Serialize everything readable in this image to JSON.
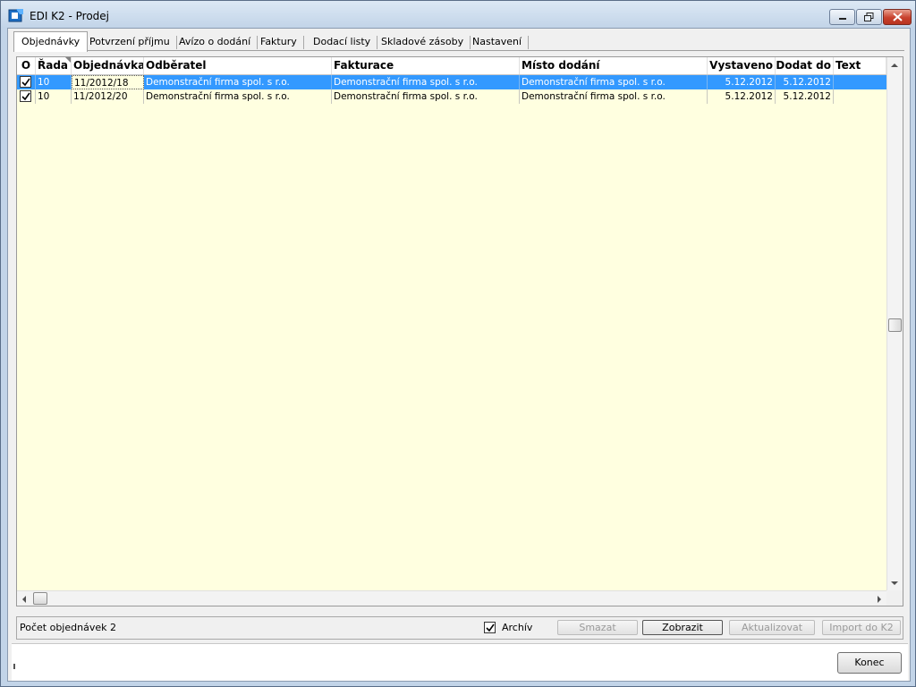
{
  "window": {
    "title": "EDI K2 - Prodej",
    "icon": "k2-app-icon"
  },
  "tabs": [
    {
      "label": "Objednávky",
      "active": true
    },
    {
      "label": "Potvrzení příjmu"
    },
    {
      "label": "Avízo o dodání"
    },
    {
      "label": "Faktury"
    },
    {
      "label": "Dodací listy"
    },
    {
      "label": "Skladové zásoby"
    },
    {
      "label": "Nastavení"
    }
  ],
  "grid": {
    "columns": [
      "O",
      "Řada",
      "Objednávka",
      "Odběratel",
      "Fakturace",
      "Místo dodání",
      "Vystaveno",
      "Dodat do",
      "Text"
    ],
    "rows": [
      {
        "checked": true,
        "rada": "10",
        "objednavka": "11/2012/18",
        "odberatel": "Demonstrační firma spol. s r.o.",
        "fakturace": "Demonstrační firma spol. s r.o.",
        "misto": "Demonstrační firma spol. s r.o.",
        "vystaveno": "5.12.2012",
        "dodat": "5.12.2012",
        "text": "",
        "selected": true
      },
      {
        "checked": true,
        "rada": "10",
        "objednavka": "11/2012/20",
        "odberatel": "Demonstrační firma spol. s r.o.",
        "fakturace": "Demonstrační firma spol. s r.o.",
        "misto": "Demonstrační firma spol. s r.o.",
        "vystaveno": "5.12.2012",
        "dodat": "5.12.2012",
        "text": ""
      }
    ],
    "background_color": "#ffffe0",
    "selection_color": "#3399ff"
  },
  "status": {
    "count_label": "Počet objednávek 2",
    "archiv_label": "Archív",
    "archiv_checked": true
  },
  "buttons": {
    "smazat": "Smazat",
    "zobrazit": "Zobrazit",
    "aktualizovat": "Aktualizovat",
    "import": "Import do K2",
    "konec": "Konec"
  }
}
